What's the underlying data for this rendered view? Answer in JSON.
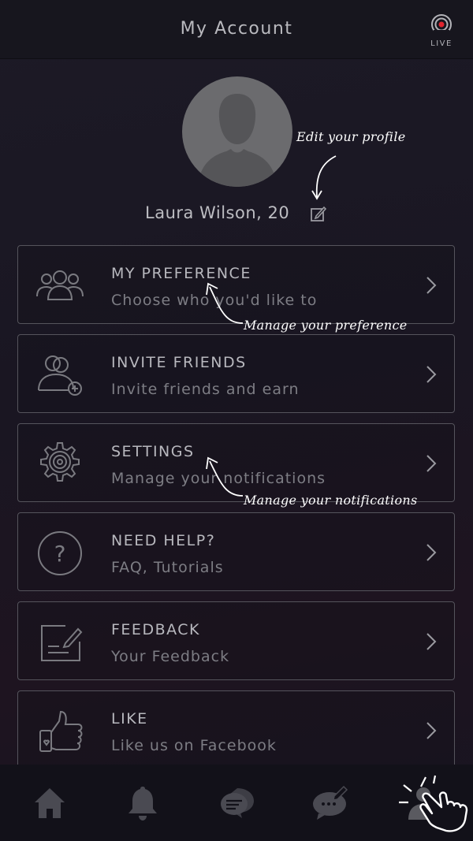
{
  "header": {
    "title": "My Account",
    "live_label": "LIVE"
  },
  "profile": {
    "name": "Laura Wilson, 20"
  },
  "hints": {
    "edit_profile": "Edit your profile",
    "manage_preference": "Manage your preference",
    "manage_notifications": "Manage your notifications"
  },
  "menu": [
    {
      "title": "MY PREFERENCE",
      "subtitle": "Choose who you'd like to",
      "icon": "group-icon"
    },
    {
      "title": "INVITE FRIENDS",
      "subtitle": "Invite friends and earn",
      "icon": "add-friend-icon"
    },
    {
      "title": "SETTINGS",
      "subtitle": "Manage your notifications",
      "icon": "gear-icon"
    },
    {
      "title": "NEED HELP?",
      "subtitle": "FAQ, Tutorials",
      "icon": "help-icon"
    },
    {
      "title": "FEEDBACK",
      "subtitle": "Your Feedback",
      "icon": "feedback-icon"
    },
    {
      "title": "LIKE",
      "subtitle": "Like us on Facebook",
      "icon": "thumbs-up-icon"
    }
  ],
  "bottom_nav": [
    "home-icon",
    "bell-icon",
    "chat-icon",
    "message-icon",
    "profile-icon"
  ],
  "colors": {
    "background": "#1a1822",
    "card_border": "#55545c",
    "icon": "#7a7a80",
    "active_tab": "#5a5a60"
  }
}
